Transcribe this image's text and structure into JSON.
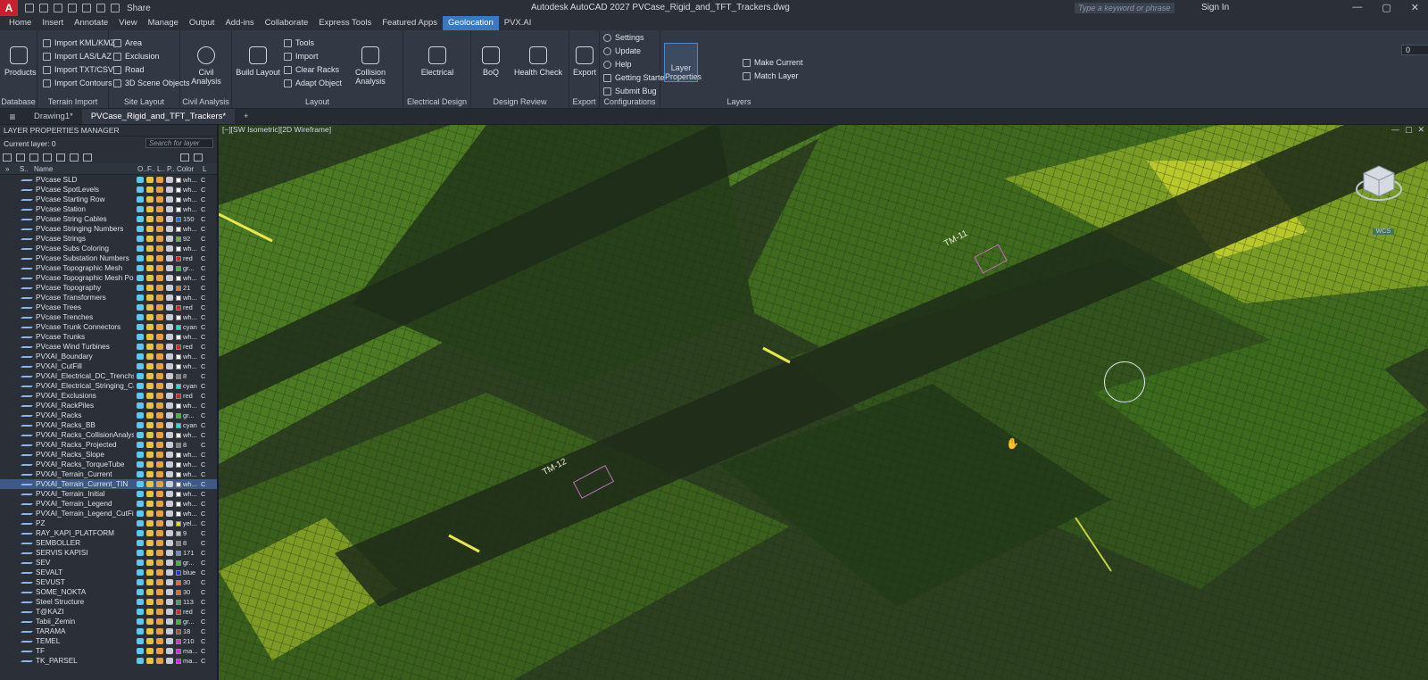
{
  "app": {
    "logo": "A",
    "title": "Autodesk AutoCAD 2027    PVCase_Rigid_and_TFT_Trackers.dwg",
    "share": "Share",
    "search_placeholder": "Type a keyword or phrase",
    "signin": "Sign In"
  },
  "menu": [
    "Home",
    "Insert",
    "Annotate",
    "View",
    "Manage",
    "Output",
    "Add-ins",
    "Collaborate",
    "Express Tools",
    "Featured Apps",
    "Geolocation",
    "PVX.AI"
  ],
  "ribbon": {
    "products": "Products",
    "database": "Database",
    "terrain_import": [
      "Import KML/KMZ",
      "Import LAS/LAZ",
      "Import TXT/CSV",
      "Import Contours"
    ],
    "terrain_title": "Terrain Import",
    "site_layout": [
      "Area",
      "Exclusion",
      "Road",
      "3D Scene Objects"
    ],
    "site_title": "Site Layout",
    "civil_analysis": "Civil Analysis",
    "civil_title": "Civil Analysis",
    "build_layout": "Build Layout",
    "tools": [
      "Tools",
      "Import",
      "Clear Racks",
      "Adapt Object"
    ],
    "collision": "Collision Analysis",
    "layout_title": "Layout",
    "electrical": "Electrical",
    "electrical_title": "Electrical Design",
    "boq": "BoQ",
    "health": "Health Check",
    "design_review": "Design Review",
    "export": "Export",
    "export_title": "Export",
    "config": [
      "Settings",
      "Update",
      "Help",
      "Getting Started",
      "Submit Bug"
    ],
    "config_title": "Configurations",
    "layer_props": "Layer Properties",
    "layer_current": "0",
    "make_current": "Make Current",
    "match_layer": "Match Layer",
    "layers_title": "Layers"
  },
  "doctabs": [
    "Drawing1*",
    "PVCase_Rigid_and_TFT_Trackers*"
  ],
  "lpm": {
    "title": "LAYER PROPERTIES MANAGER",
    "current": "Current layer: 0",
    "search": "Search for layer",
    "cols": [
      "S..",
      "Name",
      "O..",
      "F..",
      "L..",
      "P..",
      "Color",
      "L"
    ],
    "layers": [
      {
        "n": "PVcase SLD",
        "c": "wh...",
        "hex": "#ffffff"
      },
      {
        "n": "PVcase SpotLevels",
        "c": "wh...",
        "hex": "#ffffff"
      },
      {
        "n": "PVcase Starting Row",
        "c": "wh...",
        "hex": "#ffffff"
      },
      {
        "n": "PVcase Station",
        "c": "wh...",
        "hex": "#ffffff"
      },
      {
        "n": "PVcase String Cables",
        "c": "150",
        "hex": "#1f6fe0"
      },
      {
        "n": "PVcase Stringing Numbers",
        "c": "wh...",
        "hex": "#ffffff"
      },
      {
        "n": "PVcase Strings",
        "c": "92",
        "hex": "#6ab43c"
      },
      {
        "n": "PVcase Subs Coloring",
        "c": "wh...",
        "hex": "#ffffff"
      },
      {
        "n": "PVcase Substation Numbers",
        "c": "red",
        "hex": "#e02020"
      },
      {
        "n": "PVcase Topographic Mesh",
        "c": "gr...",
        "hex": "#30c030"
      },
      {
        "n": "PVcase Topographic Mesh Poly...",
        "c": "wh...",
        "hex": "#ffffff"
      },
      {
        "n": "PVcase Topography",
        "c": "21",
        "hex": "#e07a30"
      },
      {
        "n": "PVcase Transformers",
        "c": "wh...",
        "hex": "#ffffff"
      },
      {
        "n": "PVcase Trees",
        "c": "red",
        "hex": "#e02020"
      },
      {
        "n": "PVcase Trenches",
        "c": "wh...",
        "hex": "#ffffff"
      },
      {
        "n": "PVcase Trunk Connectors",
        "c": "cyan",
        "hex": "#20e0e0"
      },
      {
        "n": "PVcase Trunks",
        "c": "wh...",
        "hex": "#ffffff"
      },
      {
        "n": "PVcase Wind Turbines",
        "c": "red",
        "hex": "#e02020"
      },
      {
        "n": "PVXAI_Boundary",
        "c": "wh...",
        "hex": "#ffffff"
      },
      {
        "n": "PVXAI_CutFill",
        "c": "wh...",
        "hex": "#ffffff"
      },
      {
        "n": "PVXAI_Electrical_DC_Trenchs",
        "c": "8",
        "hex": "#808080"
      },
      {
        "n": "PVXAI_Electrical_Stringing_Cab...",
        "c": "cyan",
        "hex": "#20e0e0"
      },
      {
        "n": "PVXAI_Exclusions",
        "c": "red",
        "hex": "#e02020"
      },
      {
        "n": "PVXAI_RackPiles",
        "c": "wh...",
        "hex": "#ffffff"
      },
      {
        "n": "PVXAI_Racks",
        "c": "gr...",
        "hex": "#30c030"
      },
      {
        "n": "PVXAI_Racks_BB",
        "c": "cyan",
        "hex": "#20e0e0"
      },
      {
        "n": "PVXAI_Racks_CollisionAnalysis",
        "c": "wh...",
        "hex": "#ffffff"
      },
      {
        "n": "PVXAI_Racks_Projected",
        "c": "8",
        "hex": "#808080"
      },
      {
        "n": "PVXAI_Racks_Slope",
        "c": "wh...",
        "hex": "#ffffff"
      },
      {
        "n": "PVXAI_Racks_TorqueTube",
        "c": "wh...",
        "hex": "#ffffff"
      },
      {
        "n": "PVXAI_Terrain_Current",
        "c": "wh...",
        "hex": "#ffffff"
      },
      {
        "n": "PVXAI_Terrain_Current_TIN",
        "c": "wh...",
        "hex": "#ffffff",
        "sel": true
      },
      {
        "n": "PVXAI_Terrain_Initial",
        "c": "wh...",
        "hex": "#ffffff"
      },
      {
        "n": "PVXAI_Terrain_Legend",
        "c": "wh...",
        "hex": "#ffffff"
      },
      {
        "n": "PVXAI_Terrain_Legend_CutFill",
        "c": "wh...",
        "hex": "#ffffff"
      },
      {
        "n": "PZ",
        "c": "yel...",
        "hex": "#e0e020"
      },
      {
        "n": "RAY_KAPI_PLATFORM",
        "c": "9",
        "hex": "#c0c0c0"
      },
      {
        "n": "SEMBOLLER",
        "c": "8",
        "hex": "#808080"
      },
      {
        "n": "SERVIS KAPISI",
        "c": "171",
        "hex": "#6a8ad0"
      },
      {
        "n": "SEV",
        "c": "gr...",
        "hex": "#30c030"
      },
      {
        "n": "SEVALT",
        "c": "blue",
        "hex": "#2030e0"
      },
      {
        "n": "SEVUST",
        "c": "30",
        "hex": "#e06a20"
      },
      {
        "n": "SOME_NOKTA",
        "c": "30",
        "hex": "#e06a20"
      },
      {
        "n": "Steel Structure",
        "c": "113",
        "hex": "#40a060"
      },
      {
        "n": "T@KAZI",
        "c": "red",
        "hex": "#e02020"
      },
      {
        "n": "Tabii_Zemin",
        "c": "gr...",
        "hex": "#30c030"
      },
      {
        "n": "TARAMA",
        "c": "18",
        "hex": "#a05030"
      },
      {
        "n": "TEMEL",
        "c": "210",
        "hex": "#d030d0"
      },
      {
        "n": "TF",
        "c": "ma...",
        "hex": "#e020e0"
      },
      {
        "n": "TK_PARSEL",
        "c": "ma...",
        "hex": "#e020e0"
      }
    ]
  },
  "viewport": {
    "label": "[−][SW Isometric][2D Wireframe]",
    "tm11": "TM-11",
    "tm12": "TM-12",
    "wcs": "WCS"
  }
}
